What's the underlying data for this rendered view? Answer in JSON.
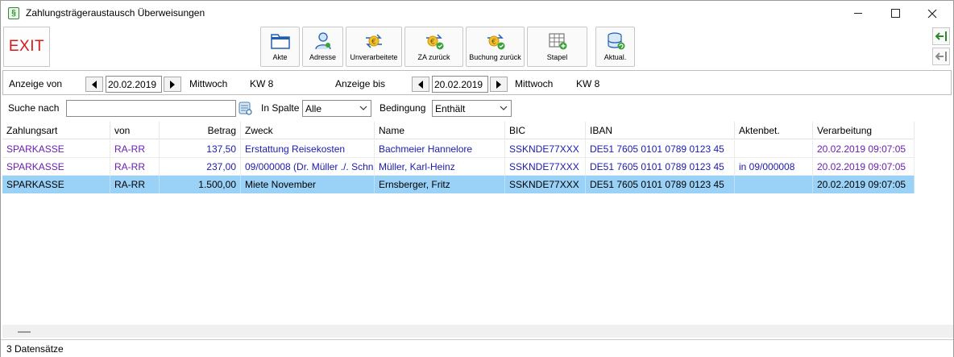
{
  "window": {
    "title": "Zahlungsträgeraustausch Überweisungen",
    "app_icon_glyph": "§"
  },
  "toolbar": {
    "exit_label": "EXIT",
    "buttons": [
      {
        "label": "Akte",
        "icon": "folder-icon"
      },
      {
        "label": "Adresse",
        "icon": "person-icon"
      },
      {
        "label": "Unverarbeitete",
        "icon": "euro-exchange-icon"
      },
      {
        "label": "ZA zurück",
        "icon": "euro-check-icon"
      },
      {
        "label": "Buchung zurück",
        "icon": "euro-check-icon"
      },
      {
        "label": "Stapel",
        "icon": "grid-add-icon"
      },
      {
        "label": "Aktual.",
        "icon": "database-refresh-icon"
      }
    ]
  },
  "datebar": {
    "from_label": "Anzeige von",
    "from_date": "20.02.2019",
    "from_weekday": "Mittwoch",
    "from_week": "KW 8",
    "to_label": "Anzeige bis",
    "to_date": "20.02.2019",
    "to_weekday": "Mittwoch",
    "to_week": "KW 8"
  },
  "search": {
    "label": "Suche nach",
    "value": "",
    "column_label": "In Spalte",
    "column_value": "Alle",
    "condition_label": "Bedingung",
    "condition_value": "Enthält"
  },
  "table": {
    "columns": [
      "Zahlungsart",
      "von",
      "Betrag",
      "Zweck",
      "Name",
      "BIC",
      "IBAN",
      "Aktenbet.",
      "Verarbeitung"
    ],
    "rows": [
      [
        "SPARKASSE",
        "RA-RR",
        "137,50",
        "Erstattung Reisekosten",
        "Bachmeier Hannelore",
        "SSKNDE77XXX",
        "DE51 7605 0101 0789 0123 45",
        "",
        "20.02.2019 09:07:05"
      ],
      [
        "SPARKASSE",
        "RA-RR",
        "237,00",
        "09/000008 (Dr. Müller ./. Schn",
        "Müller, Karl-Heinz",
        "SSKNDE77XXX",
        "DE51 7605 0101 0789 0123 45",
        "in 09/000008",
        "20.02.2019 09:07:05"
      ],
      [
        "SPARKASSE",
        "RA-RR",
        "1.500,00",
        "Miete November",
        "Ernsberger, Fritz",
        "SSKNDE77XXX",
        "DE51 7605 0101 0789 0123 45",
        "",
        "20.02.2019 09:07:05"
      ]
    ],
    "selected_row": 2
  },
  "status": {
    "count_text": "3 Datensätze"
  },
  "colors": {
    "exit_red": "#d61a1a",
    "row_text_blue": "#1a1ab0",
    "row_text_purple": "#6a1fb3",
    "selected_row": "#99d1f7"
  }
}
